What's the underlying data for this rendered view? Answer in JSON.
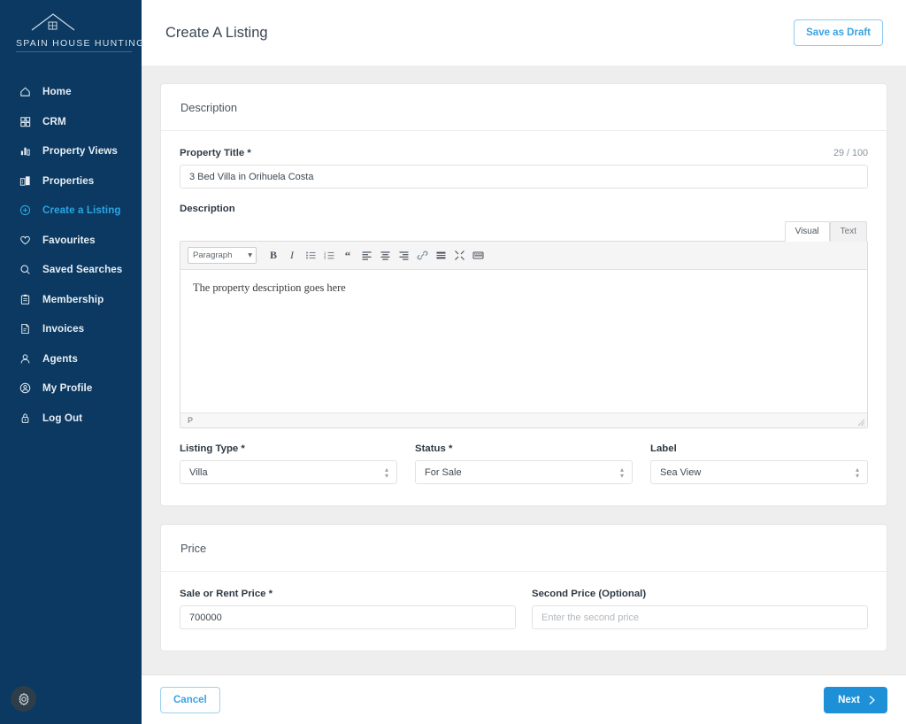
{
  "brand": {
    "name": "SPAIN HOUSE HUNTING",
    "logo_icon": "house-roof-icon"
  },
  "colors": {
    "sidebar_bg": "#0b3961",
    "accent_blue": "#2ba6e3",
    "primary_button": "#1e90d8",
    "page_bg": "#eeeeee"
  },
  "sidebar": {
    "items": [
      {
        "label": "Home",
        "icon": "home-icon",
        "active": false
      },
      {
        "label": "CRM",
        "icon": "grid-icon",
        "active": false
      },
      {
        "label": "Property Views",
        "icon": "bar-chart-icon",
        "active": false
      },
      {
        "label": "Properties",
        "icon": "buildings-icon",
        "active": false
      },
      {
        "label": "Create a Listing",
        "icon": "plus-circle-icon",
        "active": true
      },
      {
        "label": "Favourites",
        "icon": "heart-icon",
        "active": false
      },
      {
        "label": "Saved Searches",
        "icon": "search-icon",
        "active": false
      },
      {
        "label": "Membership",
        "icon": "clipboard-icon",
        "active": false
      },
      {
        "label": "Invoices",
        "icon": "invoice-icon",
        "active": false
      },
      {
        "label": "Agents",
        "icon": "user-icon",
        "active": false
      },
      {
        "label": "My Profile",
        "icon": "user-circle-icon",
        "active": false
      },
      {
        "label": "Log Out",
        "icon": "lock-icon",
        "active": false
      }
    ],
    "settings_icon": "gear-icon"
  },
  "header": {
    "title": "Create A Listing",
    "save_draft_label": "Save as Draft"
  },
  "description_card": {
    "heading": "Description",
    "property_title": {
      "label": "Property Title *",
      "value": "3 Bed Villa in Orihuela Costa",
      "counter": "29 / 100"
    },
    "description": {
      "label": "Description",
      "tabs": [
        {
          "label": "Visual",
          "active": true
        },
        {
          "label": "Text",
          "active": false
        }
      ],
      "toolbar": {
        "format_select": "Paragraph",
        "buttons": [
          {
            "name": "bold-icon",
            "glyph": "B"
          },
          {
            "name": "italic-icon",
            "glyph": "I"
          },
          {
            "name": "bullet-list-icon",
            "glyph": ""
          },
          {
            "name": "numbered-list-icon",
            "glyph": ""
          },
          {
            "name": "blockquote-icon",
            "glyph": "“"
          },
          {
            "name": "align-left-icon",
            "glyph": ""
          },
          {
            "name": "align-center-icon",
            "glyph": ""
          },
          {
            "name": "align-right-icon",
            "glyph": ""
          },
          {
            "name": "link-icon",
            "glyph": ""
          },
          {
            "name": "read-more-icon",
            "glyph": ""
          },
          {
            "name": "fullscreen-icon",
            "glyph": ""
          },
          {
            "name": "toolbar-toggle-icon",
            "glyph": ""
          }
        ]
      },
      "content": "The property description goes here",
      "status_path": "P"
    },
    "listing_type": {
      "label": "Listing Type *",
      "value": "Villa"
    },
    "status": {
      "label": "Status *",
      "value": "For Sale"
    },
    "tag_label": {
      "label": "Label",
      "value": "Sea View"
    }
  },
  "price_card": {
    "heading": "Price",
    "sale_price": {
      "label": "Sale or Rent Price *",
      "value": "700000"
    },
    "second_price": {
      "label": "Second Price (Optional)",
      "value": "",
      "placeholder": "Enter the second price"
    }
  },
  "footer": {
    "cancel_label": "Cancel",
    "next_label": "Next"
  }
}
